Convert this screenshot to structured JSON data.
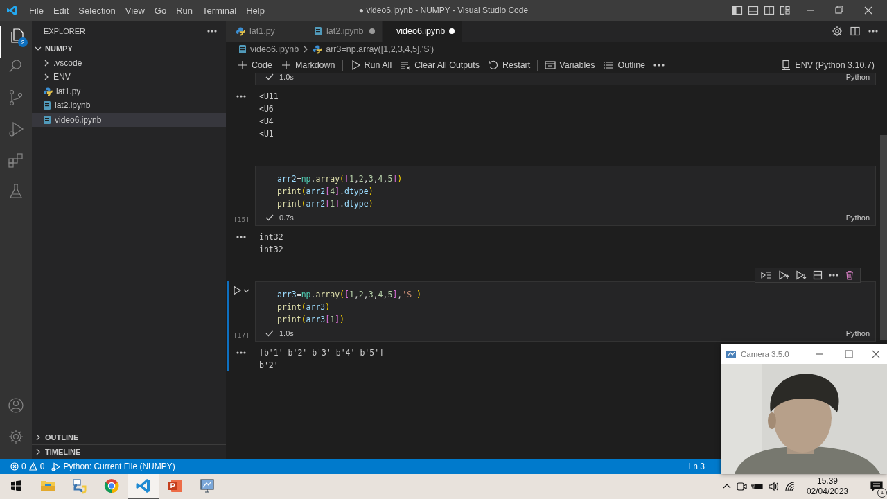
{
  "window": {
    "title": "● video6.ipynb - NUMPY - Visual Studio Code"
  },
  "menu": [
    "File",
    "Edit",
    "Selection",
    "View",
    "Go",
    "Run",
    "Terminal",
    "Help"
  ],
  "activity_bar": {
    "explorer_badge": "2"
  },
  "sidebar": {
    "title": "EXPLORER",
    "folder": {
      "label": "NUMPY",
      "expanded": true
    },
    "items": [
      {
        "label": ".vscode",
        "kind": "folder",
        "expanded": false,
        "selected": false
      },
      {
        "label": "ENV",
        "kind": "folder",
        "expanded": false,
        "selected": false
      },
      {
        "label": "lat1.py",
        "kind": "python",
        "selected": false
      },
      {
        "label": "lat2.ipynb",
        "kind": "notebook",
        "selected": false
      },
      {
        "label": "video6.ipynb",
        "kind": "notebook",
        "selected": true
      }
    ],
    "sections": [
      {
        "label": "OUTLINE",
        "expanded": false
      },
      {
        "label": "TIMELINE",
        "expanded": false
      }
    ]
  },
  "tabs": [
    {
      "label": "lat1.py",
      "kind": "python",
      "selected": false,
      "modified": false
    },
    {
      "label": "lat2.ipynb",
      "kind": "notebook",
      "selected": false,
      "modified": true
    },
    {
      "label": "video6.ipynb",
      "kind": "notebook",
      "selected": true,
      "modified": true
    }
  ],
  "breadcrumb": [
    {
      "label": "video6.ipynb",
      "kind": "notebook"
    },
    {
      "label": "arr3=np.array([1,2,3,4,5],'S')",
      "kind": "python"
    }
  ],
  "toolbar": {
    "items": [
      {
        "label": "Code",
        "kind": "add"
      },
      {
        "label": "Markdown",
        "kind": "add"
      },
      {
        "kind": "separator"
      },
      {
        "label": "Run All",
        "kind": "run"
      },
      {
        "label": "Clear All Outputs",
        "kind": "clear"
      },
      {
        "label": "Restart",
        "kind": "restart"
      },
      {
        "kind": "separator"
      },
      {
        "label": "Variables",
        "kind": "variables"
      },
      {
        "label": "Outline",
        "kind": "outline"
      },
      {
        "kind": "more"
      }
    ],
    "kernel": "ENV (Python 3.10.7)"
  },
  "cells": [
    {
      "time": "1.0s",
      "language": "Python",
      "focused": false,
      "outputs": [
        "<U11",
        "<U6",
        "<U4",
        "<U1"
      ]
    },
    {
      "number": "[15]",
      "code": [
        "arr2=np.array([1,2,3,4,5])",
        "print(arr2[4].dtype)",
        "print(arr2[1].dtype)"
      ],
      "time": "0.7s",
      "language": "Python",
      "focused": false,
      "outputs": [
        "int32",
        "int32"
      ]
    },
    {
      "number": "[17]",
      "code": [
        "arr3=np.array([1,2,3,4,5],'S')",
        "print(arr3)",
        "print(arr3[1])"
      ],
      "time": "1.0s",
      "language": "Python",
      "focused": true,
      "outputs": [
        "[b'1' b'2' b'3' b'4' b'5']",
        "b'2'"
      ]
    }
  ],
  "status_bar": {
    "errors": "0",
    "warnings": "0",
    "debug": "Python: Current File (NUMPY)",
    "position": "Ln 3"
  },
  "camera_window": {
    "title": "Camera 3.5.0",
    "kind": "picture"
  },
  "taskbar": {
    "apps": [
      {
        "kind": "folder",
        "selected": false
      },
      {
        "kind": "python",
        "selected": false
      },
      {
        "kind": "chrome",
        "selected": false
      },
      {
        "kind": "vscode",
        "selected": true
      },
      {
        "kind": "powerpoint",
        "selected": false
      },
      {
        "kind": "monitor",
        "selected": false
      }
    ],
    "time": "15.39",
    "date": "02/04/2023",
    "notifications": "1"
  }
}
